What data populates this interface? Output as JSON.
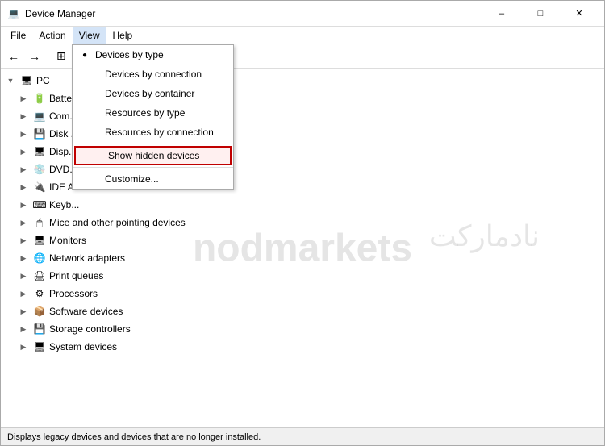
{
  "window": {
    "title": "Device Manager",
    "icon": "💻"
  },
  "titlebar": {
    "title": "Device Manager",
    "minimize_label": "–",
    "maximize_label": "□",
    "close_label": "✕"
  },
  "menubar": {
    "items": [
      {
        "id": "file",
        "label": "File"
      },
      {
        "id": "action",
        "label": "Action"
      },
      {
        "id": "view",
        "label": "View"
      },
      {
        "id": "help",
        "label": "Help"
      }
    ]
  },
  "dropdown": {
    "items": [
      {
        "id": "devices-by-type",
        "label": "Devices by type",
        "bullet": true,
        "highlighted": false
      },
      {
        "id": "devices-by-connection",
        "label": "Devices by connection",
        "bullet": false,
        "highlighted": false
      },
      {
        "id": "devices-by-container",
        "label": "Devices by container",
        "bullet": false,
        "highlighted": false
      },
      {
        "id": "resources-by-type",
        "label": "Resources by type",
        "bullet": false,
        "highlighted": false
      },
      {
        "id": "resources-by-connection",
        "label": "Resources by connection",
        "bullet": false,
        "highlighted": false
      },
      {
        "id": "show-hidden-devices",
        "label": "Show hidden devices",
        "bullet": false,
        "highlighted": true
      },
      {
        "id": "customize",
        "label": "Customize...",
        "bullet": false,
        "highlighted": false
      }
    ]
  },
  "tree": {
    "root_label": "PC",
    "items": [
      {
        "id": "batteries",
        "label": "Batte...",
        "expanded": false,
        "indent": 1
      },
      {
        "id": "computer",
        "label": "Com...",
        "expanded": false,
        "indent": 1
      },
      {
        "id": "disk-drives",
        "label": "Disk ...",
        "expanded": false,
        "indent": 1
      },
      {
        "id": "display",
        "label": "Disp...",
        "expanded": false,
        "indent": 1
      },
      {
        "id": "dvd",
        "label": "DVD...",
        "expanded": false,
        "indent": 1
      },
      {
        "id": "ide",
        "label": "IDE A...",
        "expanded": false,
        "indent": 1
      },
      {
        "id": "keyboards",
        "label": "Keyb...",
        "expanded": false,
        "indent": 1
      },
      {
        "id": "mice",
        "label": "Mice and other pointing devices",
        "expanded": false,
        "indent": 1
      },
      {
        "id": "monitors",
        "label": "Monitors",
        "expanded": false,
        "indent": 1
      },
      {
        "id": "network",
        "label": "Network adapters",
        "expanded": false,
        "indent": 1
      },
      {
        "id": "print-queues",
        "label": "Print queues",
        "expanded": false,
        "indent": 1
      },
      {
        "id": "processors",
        "label": "Processors",
        "expanded": false,
        "indent": 1
      },
      {
        "id": "software-devices",
        "label": "Software devices",
        "expanded": false,
        "indent": 1
      },
      {
        "id": "storage-controllers",
        "label": "Storage controllers",
        "expanded": false,
        "indent": 1
      },
      {
        "id": "system-devices",
        "label": "System devices",
        "expanded": false,
        "indent": 1
      }
    ]
  },
  "statusbar": {
    "text": "Displays legacy devices and devices that are no longer installed."
  },
  "watermark": {
    "text_en": "nodmarkets",
    "text_ar": "نادمارکت"
  }
}
